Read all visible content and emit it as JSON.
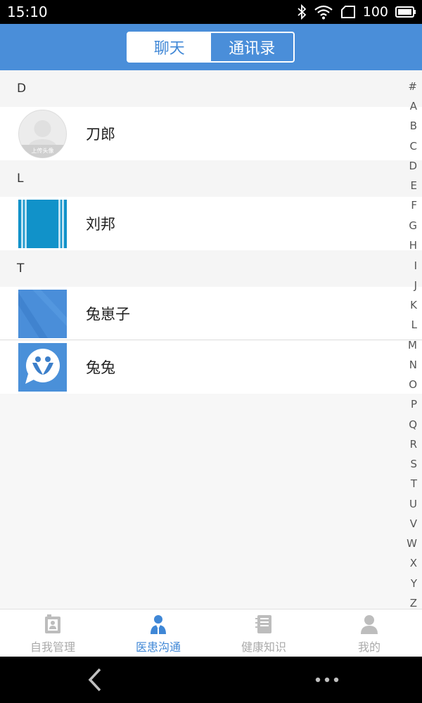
{
  "status_bar": {
    "time": "15:10",
    "battery": "100"
  },
  "header": {
    "tabs": [
      {
        "label": "聊天",
        "active": false
      },
      {
        "label": "通讯录",
        "active": true
      }
    ]
  },
  "sections": [
    {
      "letter": "D",
      "contacts": [
        {
          "name": "刀郎",
          "avatar": "default-avatar",
          "avatar_caption": "上传头像"
        }
      ]
    },
    {
      "letter": "L",
      "contacts": [
        {
          "name": "刘邦",
          "avatar": "striped-avatar"
        }
      ]
    },
    {
      "letter": "T",
      "contacts": [
        {
          "name": "兔崽子",
          "avatar": "blue-avatar"
        },
        {
          "name": "兔兔",
          "avatar": "chat-logo-avatar"
        }
      ]
    }
  ],
  "index_letters": [
    "#",
    "A",
    "B",
    "C",
    "D",
    "E",
    "F",
    "G",
    "H",
    "I",
    "J",
    "K",
    "L",
    "M",
    "N",
    "O",
    "P",
    "Q",
    "R",
    "S",
    "T",
    "U",
    "V",
    "W",
    "X",
    "Y",
    "Z"
  ],
  "bottom_nav": [
    {
      "label": "自我管理",
      "icon": "profile-card-icon",
      "active": false
    },
    {
      "label": "医患沟通",
      "icon": "doctor-icon",
      "active": true
    },
    {
      "label": "健康知识",
      "icon": "notebook-icon",
      "active": false
    },
    {
      "label": "我的",
      "icon": "user-icon",
      "active": false
    }
  ],
  "colors": {
    "primary": "#4a8ed9",
    "active_text": "#3f87d6",
    "inactive_text": "#aaaaaa",
    "section_bg": "#f5f5f5"
  }
}
